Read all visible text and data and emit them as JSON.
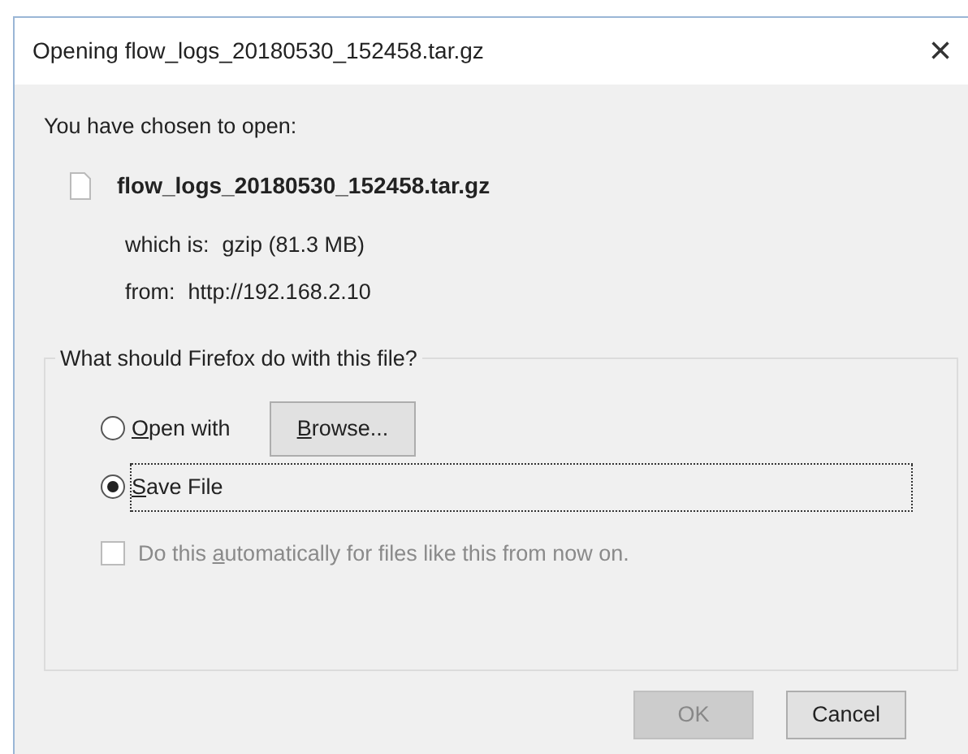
{
  "window": {
    "title": "Opening flow_logs_20180530_152458.tar.gz",
    "close": "×"
  },
  "intro": "You have chosen to open:",
  "file": {
    "name": "flow_logs_20180530_152458.tar.gz"
  },
  "details": [
    {
      "label": "which is:",
      "value": "gzip (81.3 MB)"
    },
    {
      "label": "from:",
      "value": "http://192.168.2.10"
    }
  ],
  "group": {
    "legend": "What should Firefox do with this file?",
    "options": [
      {
        "kind": "radio",
        "label": {
          "key": "O",
          "after": "pen with"
        },
        "selected": false,
        "focused": false,
        "button": {
          "label": {
            "key": "B",
            "after": "rowse..."
          }
        }
      },
      {
        "kind": "radio",
        "label": {
          "key": "S",
          "after": "ave File"
        },
        "selected": true,
        "focused": true
      }
    ],
    "checkbox": {
      "label": {
        "before": "Do this ",
        "key": "a",
        "after": "utomatically for files like this from now on."
      },
      "checked": false,
      "disabled": true
    }
  },
  "buttons": [
    {
      "label": "OK",
      "disabled": true
    },
    {
      "label": "Cancel",
      "disabled": false
    }
  ]
}
